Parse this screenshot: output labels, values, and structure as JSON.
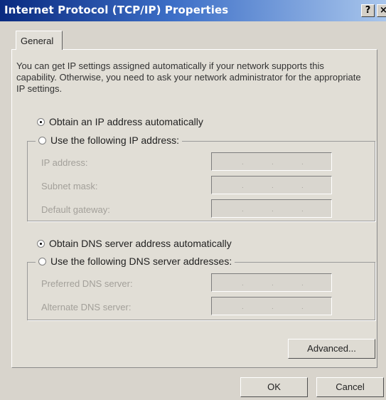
{
  "window": {
    "title": "Internet Protocol (TCP/IP) Properties",
    "help_glyph": "?",
    "close_glyph": "×"
  },
  "tabs": [
    {
      "label": "General",
      "selected": true
    }
  ],
  "description": "You can get IP settings assigned automatically if your network supports this capability. Otherwise, you need to ask your network administrator for the appropriate IP settings.",
  "ip": {
    "auto_label": "Obtain an IP address automatically",
    "manual_label": "Use the following IP address:",
    "selected": "auto",
    "fields": [
      {
        "label": "IP address:",
        "value": ""
      },
      {
        "label": "Subnet mask:",
        "value": ""
      },
      {
        "label": "Default gateway:",
        "value": ""
      }
    ]
  },
  "dns": {
    "auto_label": "Obtain DNS server address automatically",
    "manual_label": "Use the following DNS server addresses:",
    "selected": "auto",
    "fields": [
      {
        "label": "Preferred DNS server:",
        "value": ""
      },
      {
        "label": "Alternate DNS server:",
        "value": ""
      }
    ]
  },
  "buttons": {
    "advanced": "Advanced...",
    "ok": "OK",
    "cancel": "Cancel"
  }
}
